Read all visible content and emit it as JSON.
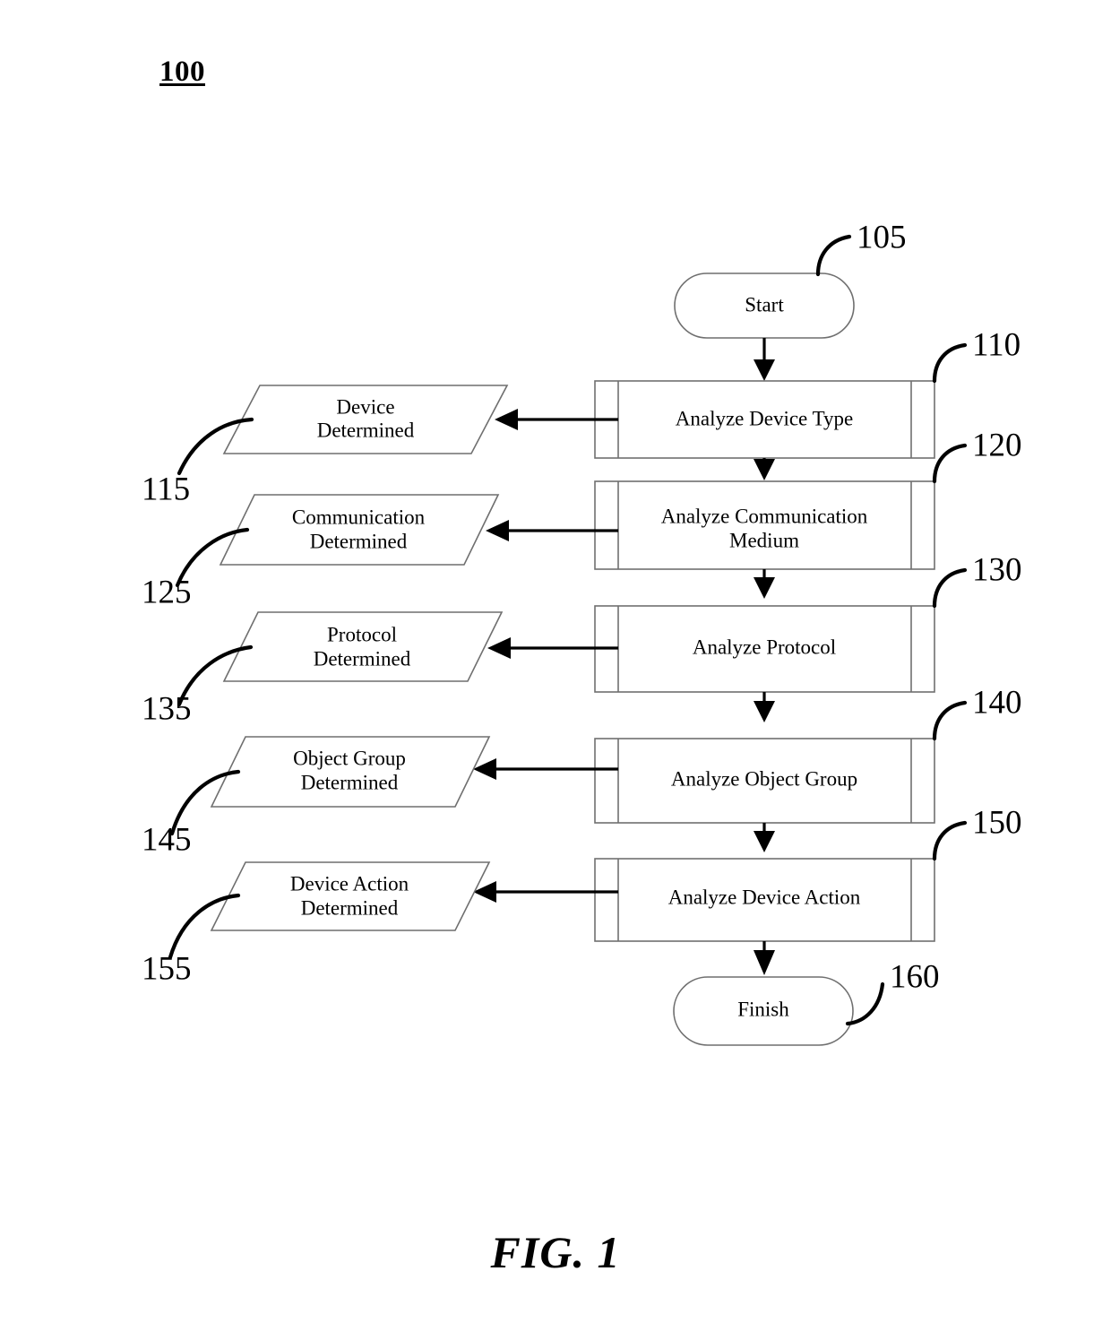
{
  "figure": {
    "system_label": "100",
    "caption": "FIG. 1"
  },
  "nodes": {
    "start": {
      "label": "Start",
      "ref": "105"
    },
    "finish": {
      "label": "Finish",
      "ref": "160"
    }
  },
  "process_steps": [
    {
      "label": "Analyze Device Type",
      "ref": "110"
    },
    {
      "label_line1": "Analyze Communication",
      "label_line2": "Medium",
      "ref": "120"
    },
    {
      "label": "Analyze Protocol",
      "ref": "130"
    },
    {
      "label": "Analyze Object Group",
      "ref": "140"
    },
    {
      "label": "Analyze Device Action",
      "ref": "150"
    }
  ],
  "outcome_nodes": [
    {
      "line1": "Device",
      "line2": "Determined",
      "ref": "115"
    },
    {
      "line1": "Communication",
      "line2": "Determined",
      "ref": "125"
    },
    {
      "line1": "Protocol",
      "line2": "Determined",
      "ref": "135"
    },
    {
      "line1": "Object Group",
      "line2": "Determined",
      "ref": "145"
    },
    {
      "line1": "Device Action",
      "line2": "Determined",
      "ref": "155"
    }
  ],
  "colors": {
    "shape_stroke": "#6f6f6f",
    "connector": "#000000",
    "text": "#000000",
    "background": "#ffffff"
  }
}
